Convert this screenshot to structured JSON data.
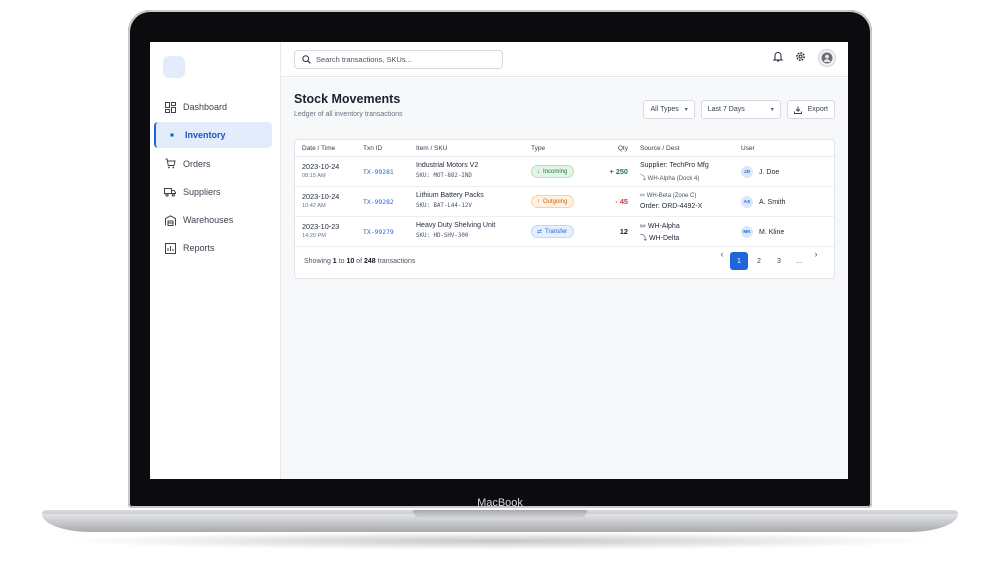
{
  "device": {
    "brand": "MacBook"
  },
  "search": {
    "placeholder": "Search transactions, SKUs..."
  },
  "sidebar": {
    "items": [
      {
        "label": "Dashboard",
        "icon": "dashboard-icon"
      },
      {
        "label": "Inventory",
        "icon": "inventory-icon",
        "active": true
      },
      {
        "label": "Orders",
        "icon": "cart-icon"
      },
      {
        "label": "Suppliers",
        "icon": "truck-icon"
      },
      {
        "label": "Warehouses",
        "icon": "warehouse-icon"
      },
      {
        "label": "Reports",
        "icon": "reports-icon"
      }
    ]
  },
  "page": {
    "title": "Stock Movements",
    "subtitle": "Ledger of all inventory transactions"
  },
  "filters": {
    "type": "All Types",
    "range": "Last 7 Days",
    "export": "Export"
  },
  "table": {
    "headers": [
      "Date / Time",
      "Txn ID",
      "Item / SKU",
      "Type",
      "Qty",
      "Source / Dest",
      "User"
    ],
    "rows": [
      {
        "date": "2023-10-24",
        "time": "08:15 AM",
        "txn": "TX-99281",
        "item": "Industrial Motors V2",
        "sku": "SKU: MOT-882-IND",
        "type": "Incoming",
        "qty": "+ 250",
        "src1": "Supplier: TechPro Mfg",
        "src2": "WH-Alpha (Dock 4)",
        "user_initials": "JD",
        "user": "J. Doe"
      },
      {
        "date": "2023-10-24",
        "time": "10:42 AM",
        "txn": "TX-99282",
        "item": "Lithium Battery Packs",
        "sku": "SKU: BAT-L44-12V",
        "type": "Outgoing",
        "qty": "- 45",
        "src1": "WH-Beta (Zone C)",
        "src2": "Order: ORD-4492-X",
        "user_initials": "AS",
        "user": "A. Smith"
      },
      {
        "date": "2023-10-23",
        "time": "14:20 PM",
        "txn": "TX-99279",
        "item": "Heavy Duty Shelving Unit",
        "sku": "SKU: HD-SHV-300",
        "type": "Transfer",
        "qty": "12",
        "src1": "WH-Alpha",
        "src2": "WH-Delta",
        "user_initials": "MK",
        "user": "M. Kline"
      }
    ]
  },
  "footer": {
    "showing_prefix": "Showing ",
    "from": "1",
    "to_word": " to ",
    "to": "10",
    "of_word": " of ",
    "total": "248",
    "suffix": " transactions"
  },
  "pagination": {
    "pages": [
      "1",
      "2",
      "3",
      "..."
    ],
    "prev": "‹",
    "next": "›"
  },
  "colors": {
    "accent": "#1f66d8",
    "incoming": "#207a36",
    "outgoing": "#c46a14",
    "negative": "#d23b3b"
  }
}
